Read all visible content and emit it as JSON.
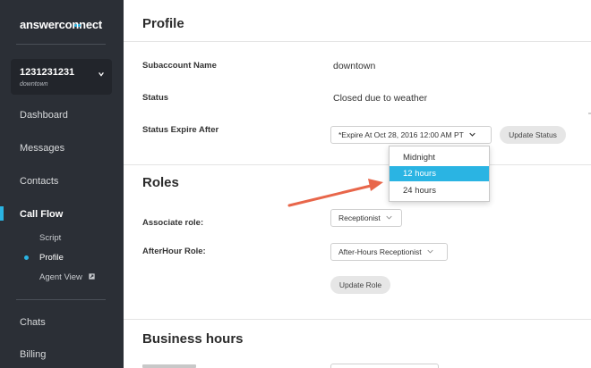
{
  "sidebar": {
    "logo_text": "answerconnect",
    "account": {
      "id": "1231231231",
      "name": "downtown"
    },
    "nav": {
      "dashboard": "Dashboard",
      "messages": "Messages",
      "contacts": "Contacts",
      "call_flow": "Call Flow",
      "chats": "Chats",
      "billing": "Billing"
    },
    "sub": {
      "script": "Script",
      "profile": "Profile",
      "agent_view": "Agent View"
    }
  },
  "main": {
    "profile": {
      "title": "Profile",
      "subaccount_label": "Subaccount Name",
      "subaccount_value": "downtown",
      "status_label": "Status",
      "status_value": "Closed due to weather",
      "expire_label": "Status Expire After",
      "expire_select": "*Expire At Oct 28, 2016 12:00 AM PT",
      "update_status": "Update Status"
    },
    "expire_dropdown": {
      "options": [
        "Midnight",
        "12 hours",
        "24 hours"
      ],
      "selected": "12 hours"
    },
    "roles": {
      "title": "Roles",
      "associate_label": "Associate role:",
      "associate_value": "Receptionist",
      "afterhour_label": "AfterHour Role:",
      "afterhour_value": "After-Hours Receptionist",
      "update_role": "Update Role"
    },
    "business_hours": {
      "title": "Business hours"
    }
  },
  "colors": {
    "accent": "#2ab4e3",
    "arrow": "#e8664a",
    "sidebar": "#2b2f36"
  }
}
